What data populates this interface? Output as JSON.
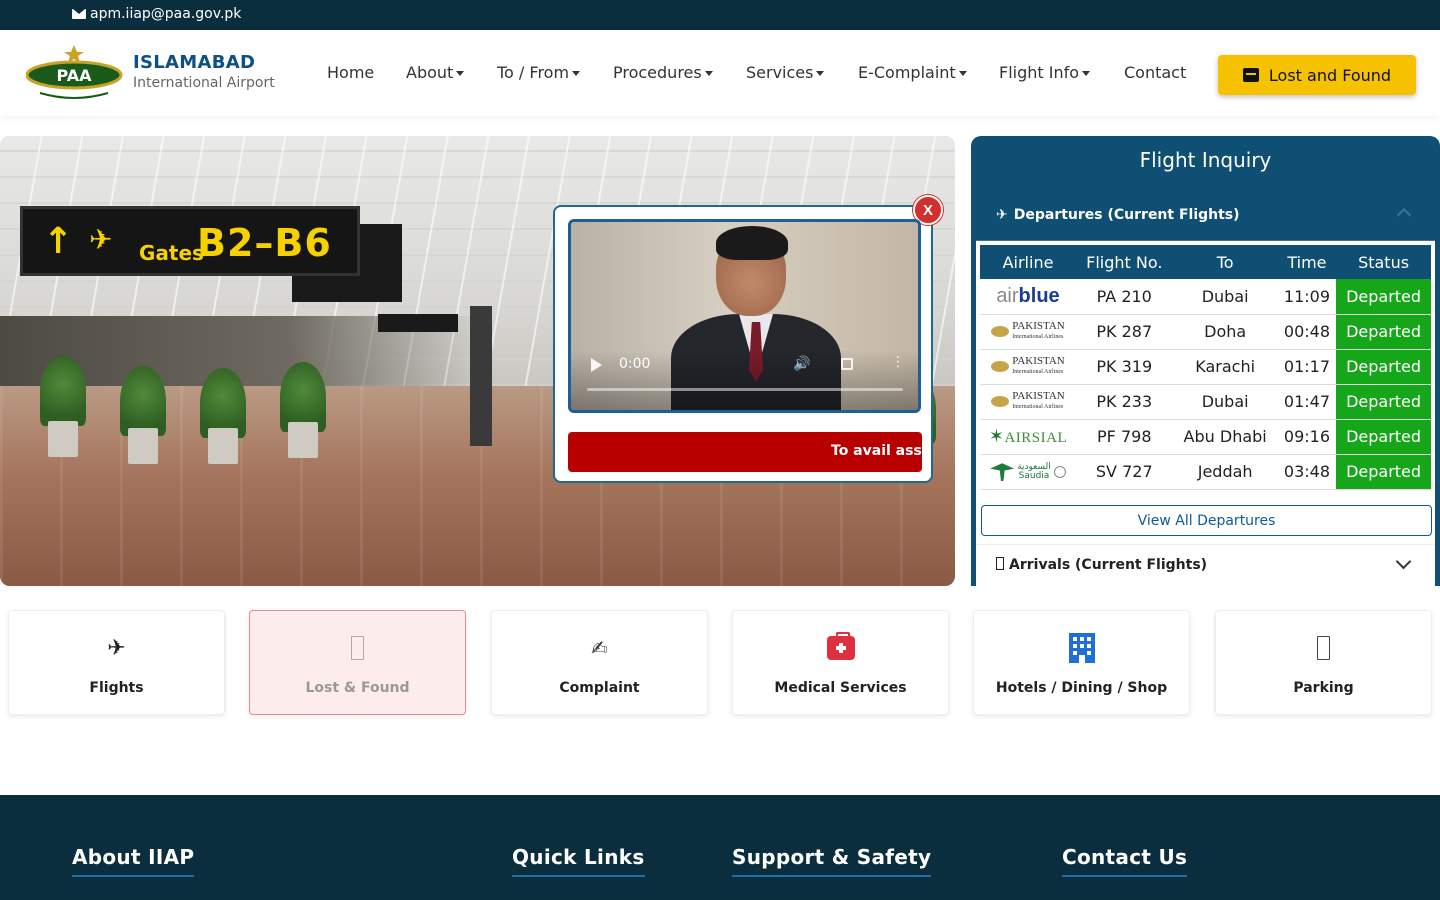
{
  "topbar": {
    "email": "apm.iiap@paa.gov.pk",
    "email_icon": "envelope-icon"
  },
  "brand": {
    "logo_text": "PAA",
    "title": "ISLAMABAD",
    "subtitle": "International Airport"
  },
  "nav": {
    "home": "Home",
    "about": "About",
    "to_from": "To / From",
    "procedures": "Procedures",
    "services": "Services",
    "ecomplaint": "E-Complaint",
    "flight_info": "Flight Info",
    "contact": "Contact"
  },
  "lost_found_button": "Lost and Found",
  "hero": {
    "sign_gates": "Gates",
    "sign_code": "B2–B6",
    "video": {
      "time": "0:00"
    },
    "marquee_text": "To avail assi"
  },
  "flight_inquiry": {
    "title": "Flight Inquiry",
    "departures_header": "Departures (Current Flights)",
    "columns": [
      "Airline",
      "Flight No.",
      "To",
      "Time",
      "Status"
    ],
    "rows": [
      {
        "airline": "airblue",
        "flight": "PA 210",
        "to": "Dubai",
        "time": "11:09",
        "status": "Departed"
      },
      {
        "airline": "PAKISTAN",
        "flight": "PK 287",
        "to": "Doha",
        "time": "00:48",
        "status": "Departed"
      },
      {
        "airline": "PAKISTAN",
        "flight": "PK 319",
        "to": "Karachi",
        "time": "01:17",
        "status": "Departed"
      },
      {
        "airline": "PAKISTAN",
        "flight": "PK 233",
        "to": "Dubai",
        "time": "01:47",
        "status": "Departed"
      },
      {
        "airline": "AIRSIAL",
        "flight": "PF 798",
        "to": "Abu Dhabi",
        "time": "09:16",
        "status": "Departed"
      },
      {
        "airline": "Saudia",
        "flight": "SV 727",
        "to": "Jeddah",
        "time": "03:48",
        "status": "Departed"
      }
    ],
    "view_all": "View All Departures",
    "arrivals_header": "Arrivals (Current Flights)",
    "status_color": "#16a61a"
  },
  "quick_links": [
    {
      "label": "Flights",
      "icon": "airplane-icon"
    },
    {
      "label": "Lost & Found",
      "icon": "missing-glyph-icon"
    },
    {
      "label": "Complaint",
      "icon": "pen-icon"
    },
    {
      "label": "Medical Services",
      "icon": "first-aid-kit-icon"
    },
    {
      "label": "Hotels / Dining / Shop",
      "icon": "hotel-icon"
    },
    {
      "label": "Parking",
      "icon": "missing-glyph-icon"
    }
  ],
  "footer": {
    "about": "About IIAP",
    "quick_links": "Quick Links",
    "support": "Support & Safety",
    "contact": "Contact Us"
  },
  "colors": {
    "dark_navy": "#0b2e3f",
    "inquiry_blue": "#0f4f73",
    "accent_yellow": "#f6c200",
    "brand_blue": "#0d4f86"
  }
}
